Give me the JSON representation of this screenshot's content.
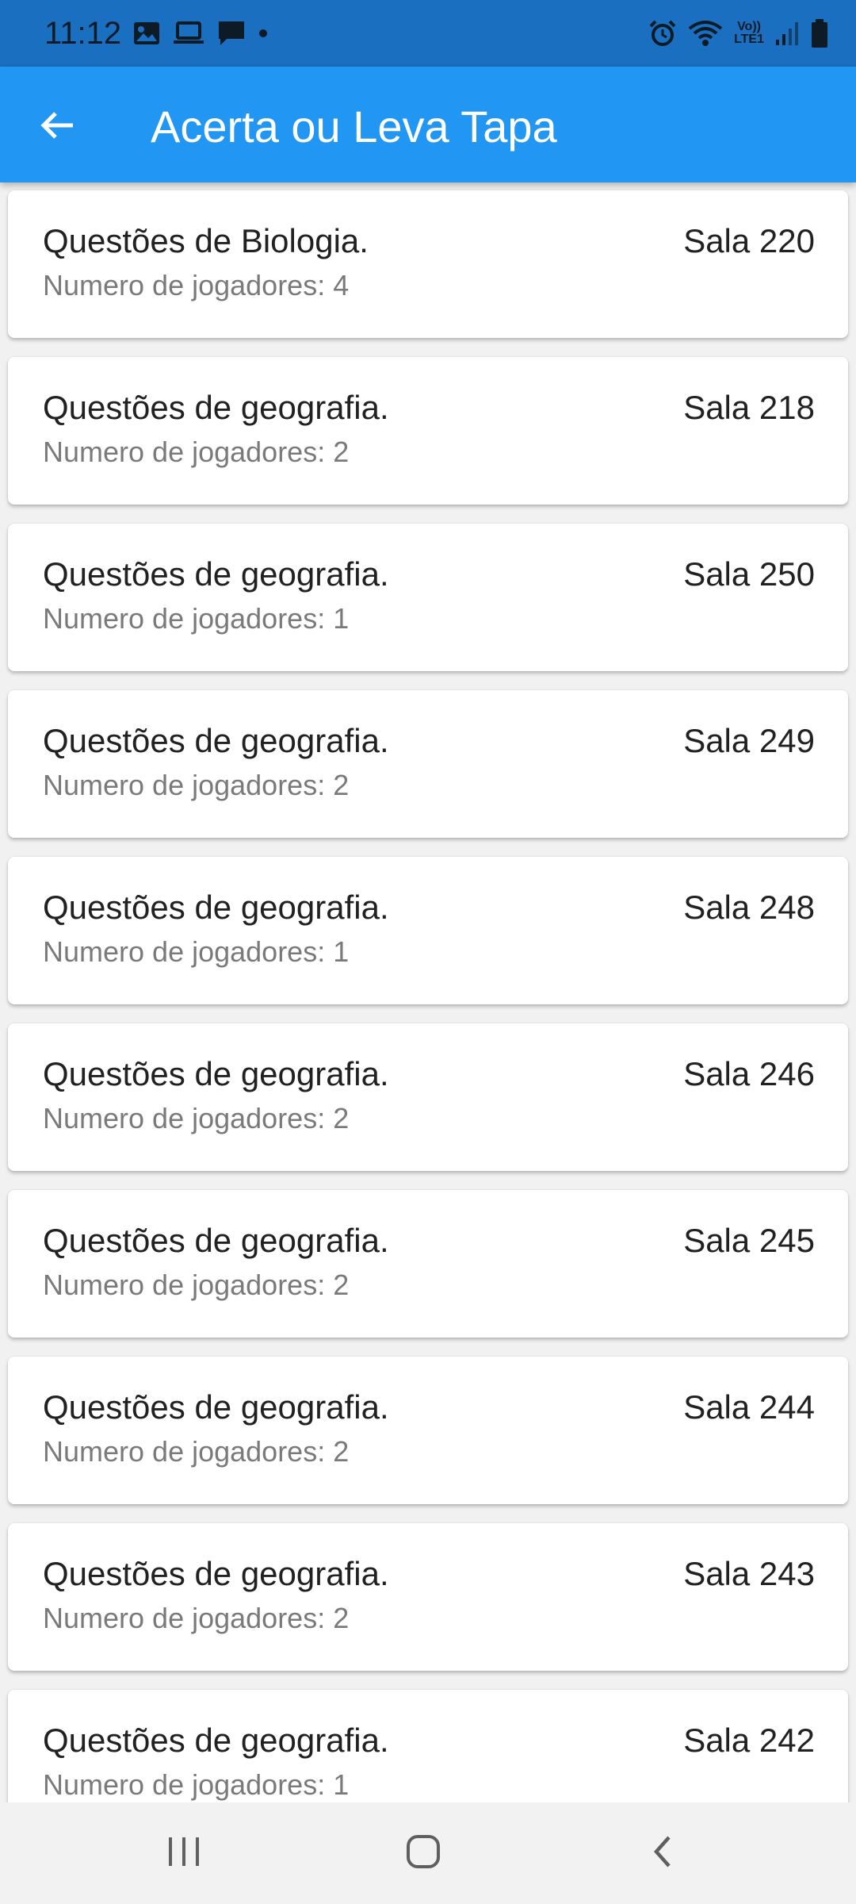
{
  "status_bar": {
    "time": "11:12",
    "left_icons": [
      "image-icon",
      "laptop-icon",
      "chat-bubble-icon",
      "dot-icon"
    ],
    "right_icons": [
      "alarm-icon",
      "wifi-icon",
      "volte-lte-icon",
      "signal-icon",
      "battery-icon"
    ],
    "lte_top": "Vo))",
    "lte_bottom": "LTE1"
  },
  "app_bar": {
    "title": "Acerta ou Leva Tapa",
    "back_icon": "arrow-left-icon",
    "color": "#2196f3"
  },
  "rooms": [
    {
      "title": "Questões de Biologia.",
      "room": "Sala 220",
      "players": "Numero de jogadores: 4"
    },
    {
      "title": "Questões de geografia.",
      "room": "Sala 218",
      "players": "Numero de jogadores: 2"
    },
    {
      "title": "Questões de geografia.",
      "room": "Sala 250",
      "players": "Numero de jogadores: 1"
    },
    {
      "title": "Questões de geografia.",
      "room": "Sala 249",
      "players": "Numero de jogadores: 2"
    },
    {
      "title": "Questões de geografia.",
      "room": "Sala 248",
      "players": "Numero de jogadores: 1"
    },
    {
      "title": "Questões de geografia.",
      "room": "Sala 246",
      "players": "Numero de jogadores: 2"
    },
    {
      "title": "Questões de geografia.",
      "room": "Sala 245",
      "players": "Numero de jogadores: 2"
    },
    {
      "title": "Questões de geografia.",
      "room": "Sala 244",
      "players": "Numero de jogadores: 2"
    },
    {
      "title": "Questões de geografia.",
      "room": "Sala 243",
      "players": "Numero de jogadores: 2"
    },
    {
      "title": "Questões de geografia.",
      "room": "Sala 242",
      "players": "Numero de jogadores: 1"
    }
  ],
  "nav_bar": {
    "buttons": [
      "recent-apps-icon",
      "home-icon",
      "back-icon"
    ]
  }
}
